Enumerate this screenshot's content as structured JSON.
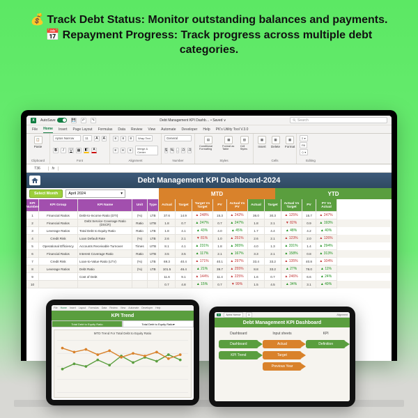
{
  "hero": {
    "l1_icon": "💰",
    "l1": "Track Debt Status: Monitor outstanding balances and payments.",
    "l2_icon": "📅",
    "l2": "Repayment Progress: Track progress across multiple debt categories."
  },
  "app": {
    "autosave": "AutoSave",
    "filename": "Debt Management KPI Dashb… • Saved ∨",
    "search_ph": "Search",
    "name_box": "T36",
    "fx": "fx"
  },
  "tabs": [
    "File",
    "Home",
    "Insert",
    "Page Layout",
    "Formulas",
    "Data",
    "Review",
    "View",
    "Automate",
    "Developer",
    "Help",
    "PK's Utility Tool V.3.0"
  ],
  "ribbon": {
    "clipboard": "Clipboard",
    "paste": "Paste",
    "font": "Font",
    "font_name": "Aptos Narrow",
    "font_size": "11",
    "alignment": "Alignment",
    "merge": "Merge & Center",
    "wrap": "Wrap Text",
    "number": "Number",
    "general": "General",
    "styles": "Styles",
    "cond": "Conditional Formatting",
    "fmt_tbl": "Format as Table",
    "cell_sty": "Cell Styles",
    "cells": "Cells",
    "insert": "Insert",
    "delete": "Delete",
    "format": "Format",
    "editing": "Editing",
    "fill": "Fill"
  },
  "dash": {
    "title": "Debt Management KPI Dashboard-2024",
    "select_month": "Select Month",
    "month": "April 2024",
    "mtd": "MTD",
    "ytd": "YTD",
    "cols": {
      "num": "KPI Number",
      "group": "KPI Group",
      "name": "KPI Name",
      "unit": "Unit",
      "type": "Type",
      "actual": "Actual",
      "target": "Target",
      "tvt": "Target Vs Target",
      "pv": "PV",
      "ava": "Actual Vs PV",
      "tvt2": "Actual Vs Target",
      "avp2": "PY Vs Actual"
    }
  },
  "rows": [
    {
      "n": 1,
      "g": "Financial Ratios",
      "name": "Debt-to-Income Ratio (DTI)",
      "u": "(%)",
      "t": "LTB",
      "ma": "37.6",
      "mt": "14.9",
      "mtv": "▲ 248%",
      "mdir": "dn",
      "mpv": "15.3",
      "mav": "▲ 242%",
      "mavd": "dn",
      "ya": "36.0",
      "yt": "30.3",
      "ytv": "▲ 125%",
      "ytd": "dn",
      "ypv": "15.7",
      "yav": "▲ 247%",
      "yavd": "dn"
    },
    {
      "n": 2,
      "g": "Financial Ratios",
      "name": "Debt Service Coverage Ratio (DSCR)",
      "u": "Ratio",
      "t": "UTB",
      "ma": "1.8",
      "mt": "0.7",
      "mtv": "▲ 247%",
      "mdir": "up",
      "mpv": "0.7",
      "mav": "▲ 247%",
      "mavd": "up",
      "ya": "1.8",
      "yt": "2.1",
      "ytv": "▼ 82%",
      "ytd": "dn",
      "ypv": "0.9",
      "yav": "▲ 193%",
      "yavd": "up"
    },
    {
      "n": 3,
      "g": "Leverage Ratios",
      "name": "Total Debt to Equity Ratio",
      "u": "Ratio",
      "t": "LTB",
      "ma": "1.8",
      "mt": "4.1",
      "mtv": "▲ 43%",
      "mdir": "up",
      "mpv": "4.0",
      "mav": "▲ 45%",
      "mavd": "up",
      "ya": "1.7",
      "yt": "4.4",
      "ytv": "▲ 48%",
      "ytd": "up",
      "ypv": "4.2",
      "yav": "▲ 40%",
      "yavd": "up"
    },
    {
      "n": 4,
      "g": "Credit Risk",
      "name": "Loan Default Rate",
      "u": "(%)",
      "t": "LTB",
      "ma": "2.6",
      "mt": "2.1",
      "mtv": "▼ 81%",
      "mdir": "dn",
      "mpv": "1.0",
      "mav": "▲ 251%",
      "mavd": "dn",
      "ya": "2.6",
      "yt": "2.1",
      "ytv": "▲ 123%",
      "ytd": "dn",
      "ypv": "2.0",
      "yav": "▲ 126%",
      "yavd": "dn"
    },
    {
      "n": 5,
      "g": "Operational Efficiency",
      "name": "Accounts Receivable Turnover",
      "u": "Times",
      "t": "UTB",
      "ma": "8.1",
      "mt": "4.1",
      "mtv": "▲ 231%",
      "mdir": "up",
      "mpv": "1.8",
      "mav": "▲ 365%",
      "mavd": "up",
      "ya": "4.0",
      "yt": "1.3",
      "ytv": "▲ 331%",
      "ytd": "up",
      "ypv": "1.4",
      "yav": "▲ 294%",
      "yavd": "up"
    },
    {
      "n": 6,
      "g": "Financial Ratios",
      "name": "Interest Coverage Ratio",
      "u": "Ratio",
      "t": "UTB",
      "ma": "3.5",
      "mt": "3.5",
      "mtv": "▲ 117%",
      "mdir": "up",
      "mpv": "2.1",
      "mav": "▲ 167%",
      "mavd": "up",
      "ya": "3.3",
      "yt": "2.1",
      "ytv": "▲ 158%",
      "ytd": "up",
      "ypv": "0.8",
      "yav": "▲ 313%",
      "yavd": "up"
    },
    {
      "n": 7,
      "g": "Credit Risk",
      "name": "Loan-to-Value Ratio (LTV)",
      "u": "(%)",
      "t": "LTB",
      "ma": "69.3",
      "mt": "40.4",
      "mtv": "▲ 171%",
      "mdir": "dn",
      "mpv": "40.1",
      "mav": "▲ 297%",
      "mavd": "dn",
      "ya": "33.4",
      "yt": "33.2",
      "ytv": "▲ 135%",
      "ytd": "dn",
      "ypv": "40.8",
      "yav": "▲ 104%",
      "yavd": "dn"
    },
    {
      "n": 8,
      "g": "Leverage Ratios",
      "name": "Debt Ratio",
      "u": "(%)",
      "t": "LTB",
      "ma": "101.5",
      "mt": "46.4",
      "mtv": "▲ 21%",
      "mdir": "up",
      "mpv": "39.7",
      "mav": "▲ 255%",
      "mavd": "dn",
      "ya": "8.8",
      "yt": "33.2",
      "ytv": "▲ 27%",
      "ytd": "up",
      "ypv": "78.0",
      "yav": "▲ 11%",
      "yavd": "up"
    },
    {
      "n": 9,
      "g": "",
      "name": "Cost of Debt",
      "u": "",
      "t": "",
      "ma": "11.6",
      "mt": "9.1",
      "mtv": "▲ 144%",
      "mdir": "dn",
      "mpv": "11.4",
      "mav": "▲ 225%",
      "mavd": "dn",
      "ya": "1.6",
      "yt": "0.7",
      "ytv": "▲ 246%",
      "ytd": "dn",
      "ypv": "6.6",
      "yav": "▲ 24%",
      "yavd": "up"
    },
    {
      "n": 10,
      "g": "",
      "name": "",
      "u": "",
      "t": "",
      "ma": "0.7",
      "mt": "4.8",
      "mtv": "▲ 15%",
      "mdir": "up",
      "mpv": "0.7",
      "mav": "▼ 99%",
      "mavd": "dn",
      "ya": "1.5",
      "yt": "4.5",
      "ytv": "▲ 34%",
      "ytd": "up",
      "ypv": "3.1",
      "yav": "▲ 49%",
      "yavd": "up"
    }
  ],
  "chart_data": {
    "type": "line",
    "title": "MTD Trend For Total Debt to Equity Ratio",
    "parent_title": "KPI Trend",
    "left_label": "Total Debt to Equity Ratio",
    "series": [
      {
        "name": "Actual",
        "values": [
          1.8,
          2.2,
          2.0,
          2.5,
          2.1,
          2.8,
          2.3,
          2.7,
          2.4,
          2.9,
          2.6,
          2.2
        ]
      },
      {
        "name": "Target",
        "values": [
          4.1,
          3.8,
          4.0,
          3.6,
          3.9,
          3.4,
          3.7,
          3.5,
          3.8,
          3.3,
          3.6,
          3.9
        ]
      }
    ],
    "x": [
      "Jan",
      "Feb",
      "Mar",
      "Apr",
      "May",
      "Jun",
      "Jul",
      "Aug",
      "Sep",
      "Oct",
      "Nov",
      "Dec"
    ]
  },
  "panel2": {
    "title": "Debt Management KPI Dashboard",
    "col1": "Dashboard",
    "col2": "Input sheets",
    "col3": "KPI",
    "b1": "Dashboard",
    "b2": "KPI Trend",
    "b3": "Actual",
    "b4": "Target",
    "b5": "Previous Year",
    "b6": "Definition",
    "font_name": "Aptos Narrow",
    "font_size": "11",
    "align_lbl": "Alignment"
  }
}
